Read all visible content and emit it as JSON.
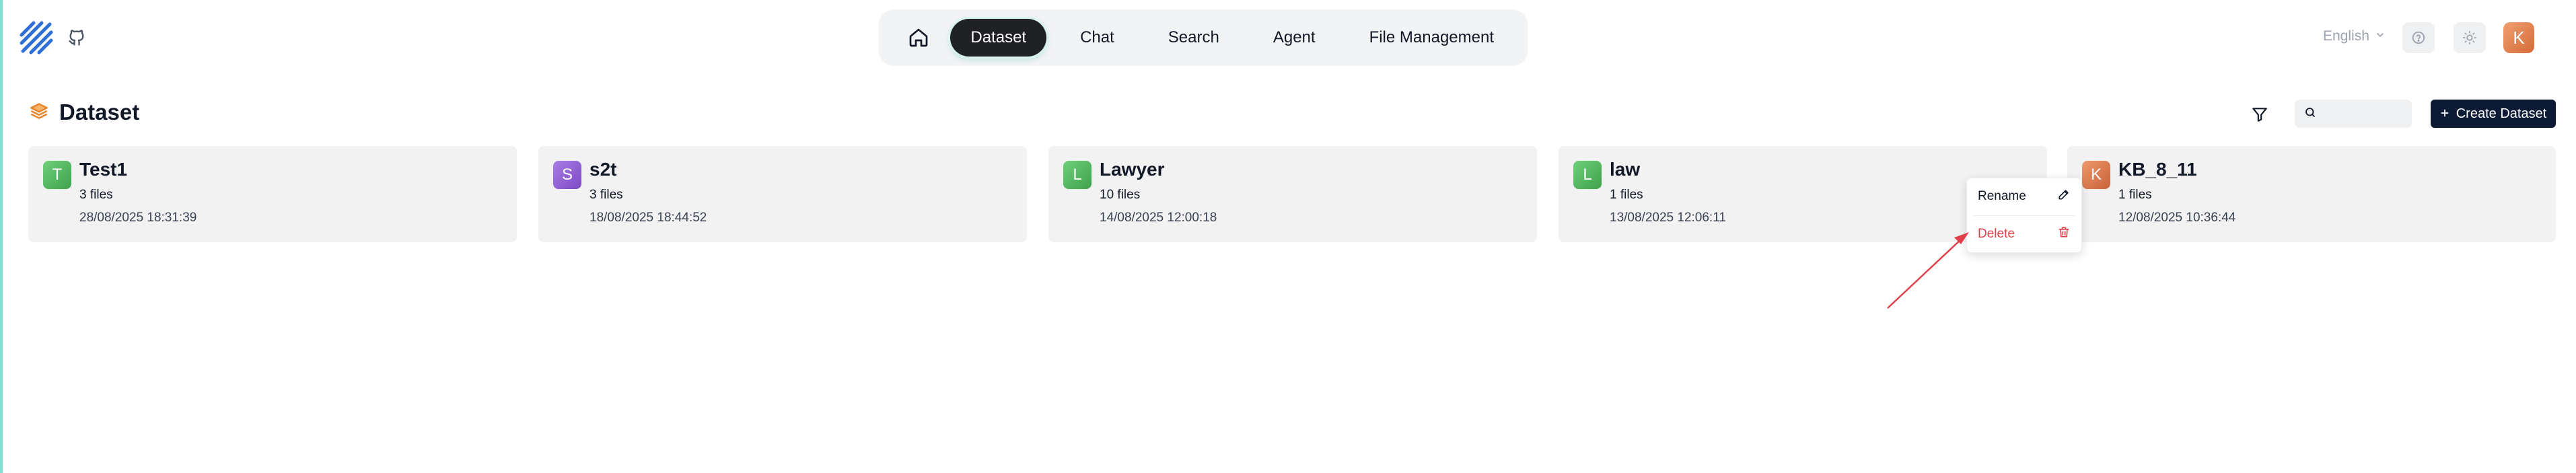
{
  "header": {
    "logo_icon": "stripes-logo-icon",
    "github_icon": "github-icon",
    "nav": {
      "home_icon": "home-icon",
      "items": [
        {
          "label": "Dataset",
          "active": true
        },
        {
          "label": "Chat",
          "active": false
        },
        {
          "label": "Search",
          "active": false
        },
        {
          "label": "Agent",
          "active": false
        },
        {
          "label": "File Management",
          "active": false
        }
      ]
    },
    "language": "English",
    "help_icon": "help-circle-icon",
    "theme_icon": "sun-icon",
    "user_initial": "K"
  },
  "page": {
    "title": "Dataset",
    "title_icon": "layers-icon",
    "filter_icon": "filter-icon",
    "search_placeholder": "",
    "create_button": "Create Dataset"
  },
  "datasets": [
    {
      "initial": "T",
      "name": "Test1",
      "files": "3 files",
      "date": "28/08/2025 18:31:39",
      "color": "#4caf50"
    },
    {
      "initial": "S",
      "name": "s2t",
      "files": "3 files",
      "date": "18/08/2025 18:44:52",
      "color": "#8e5ad0"
    },
    {
      "initial": "L",
      "name": "Lawyer",
      "files": "10 files",
      "date": "14/08/2025 12:00:18",
      "color": "#4caf50"
    },
    {
      "initial": "L",
      "name": "law",
      "files": "1 files",
      "date": "13/08/2025 12:06:11",
      "color": "#4caf50"
    },
    {
      "initial": "K",
      "name": "KB_8_11",
      "files": "1 files",
      "date": "12/08/2025 10:36:44",
      "color": "#d46a38"
    }
  ],
  "context_menu": {
    "rename": "Rename",
    "rename_icon": "pencil-icon",
    "delete": "Delete",
    "delete_icon": "trash-icon",
    "annotation_color": "#e0404a"
  },
  "colors": {
    "accent_dark": "#0c1a36",
    "nav_active": "#1f2124",
    "delete_red": "#e0404a"
  }
}
